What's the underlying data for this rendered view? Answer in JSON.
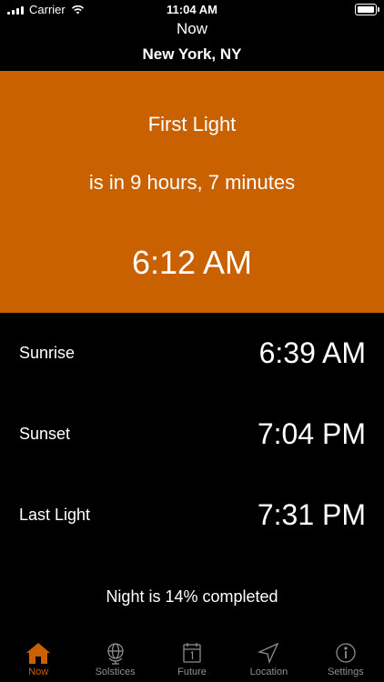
{
  "status_bar": {
    "carrier": "Carrier",
    "time": "11:04 AM"
  },
  "nav": {
    "title": "Now",
    "subtitle": "New York, NY"
  },
  "hero": {
    "event": "First Light",
    "countdown": "is in 9 hours, 7 minutes",
    "time": "6:12 AM",
    "color": "#c96100"
  },
  "rows": [
    {
      "label": "Sunrise",
      "value": "6:39 AM"
    },
    {
      "label": "Sunset",
      "value": "7:04 PM"
    },
    {
      "label": "Last Light",
      "value": "7:31 PM"
    }
  ],
  "progress_text": "Night is 14% completed",
  "tabs": [
    {
      "label": "Now",
      "icon": "house-icon",
      "active": true
    },
    {
      "label": "Solstices",
      "icon": "globe-icon",
      "active": false
    },
    {
      "label": "Future",
      "icon": "calendar-icon",
      "active": false
    },
    {
      "label": "Location",
      "icon": "location-arrow-icon",
      "active": false
    },
    {
      "label": "Settings",
      "icon": "info-icon",
      "active": false
    }
  ]
}
